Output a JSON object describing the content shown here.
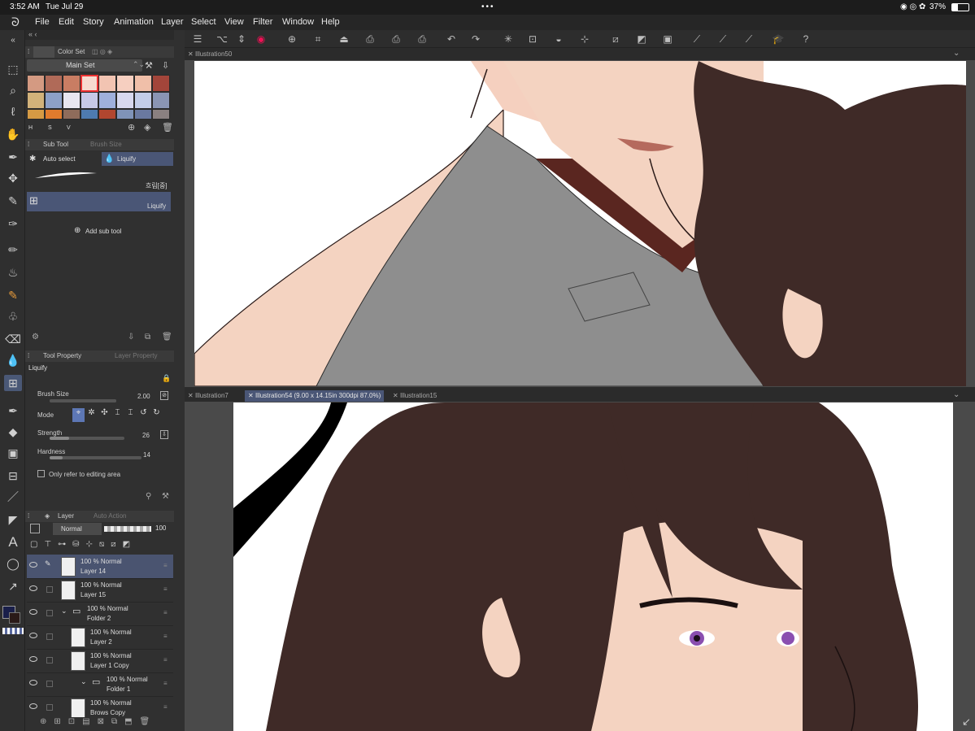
{
  "status": {
    "time": "3:52 AM",
    "date": "Tue Jul 29",
    "battery": "37%"
  },
  "menu": [
    "File",
    "Edit",
    "Story",
    "Animation",
    "Layer",
    "Select",
    "View",
    "Filter",
    "Window",
    "Help"
  ],
  "colorset": {
    "title": "Color Set",
    "set_name": "Main Set",
    "modes": [
      "H",
      "S",
      "V"
    ],
    "swatches": [
      "#d49a82",
      "#b06a58",
      "#c97d63",
      "#f7dbd0",
      "#f2c4b2",
      "#f6cfc0",
      "#f0bfa9",
      "#a3453a",
      "#d2b27a",
      "#8da0c7",
      "#e8e6f0",
      "#c7c9e6",
      "#9fb0dc",
      "#d7d8ee",
      "#c3cde8",
      "#8a95b4",
      "#d59a44",
      "#e07b2d",
      "#8f6c5b",
      "#4e7bb0",
      "#b1462f",
      "#7f93b8",
      "#6a79a0",
      "#8a8080"
    ]
  },
  "subtool": {
    "title": "Sub Tool",
    "tab2": "Brush Size",
    "items": [
      "Auto select",
      "Liquify"
    ],
    "brush_name": "흐림[중]",
    "active": "Liquify",
    "add": "Add sub tool"
  },
  "toolprop": {
    "title": "Tool Property",
    "tab2": "Layer Property",
    "tool": "Liquify",
    "brush_size_label": "Brush Size",
    "brush_size": "2.00",
    "mode_label": "Mode",
    "strength_label": "Strength",
    "strength": "26",
    "hardness_label": "Hardness",
    "hardness": "14",
    "only_ref": "Only refer to editing area",
    "strength_pct": 0.26,
    "hardness_pct": 0.14
  },
  "layers": {
    "title": "Layer",
    "tab2": "Auto Action",
    "blend": "Normal",
    "opacity": "100",
    "rows": [
      {
        "name": "Layer 14",
        "mode": "100 %  Normal"
      },
      {
        "name": "Layer 15",
        "mode": "100 %  Normal"
      },
      {
        "name": "Folder 2",
        "mode": "100 %  Normal"
      },
      {
        "name": "Layer 2",
        "mode": "100 %  Normal"
      },
      {
        "name": "Layer 1 Copy",
        "mode": "100 %  Normal"
      },
      {
        "name": "Folder 1",
        "mode": "100 %  Normal"
      },
      {
        "name": "Brows Copy",
        "mode": "100 %  Normal"
      }
    ]
  },
  "tabs_top": [
    "Illustration50"
  ],
  "tabs_bottom": [
    "Illustration7",
    "Illustration54 (9.00 x 14.15in 300dpi 87.0%)",
    "Illustration15"
  ],
  "colors": {
    "accent": "#4a5676",
    "hair": "#3f2a27",
    "shirt": "#8e8e8e",
    "skin": "#f4d3c1",
    "eye": "#8a4fb0"
  }
}
